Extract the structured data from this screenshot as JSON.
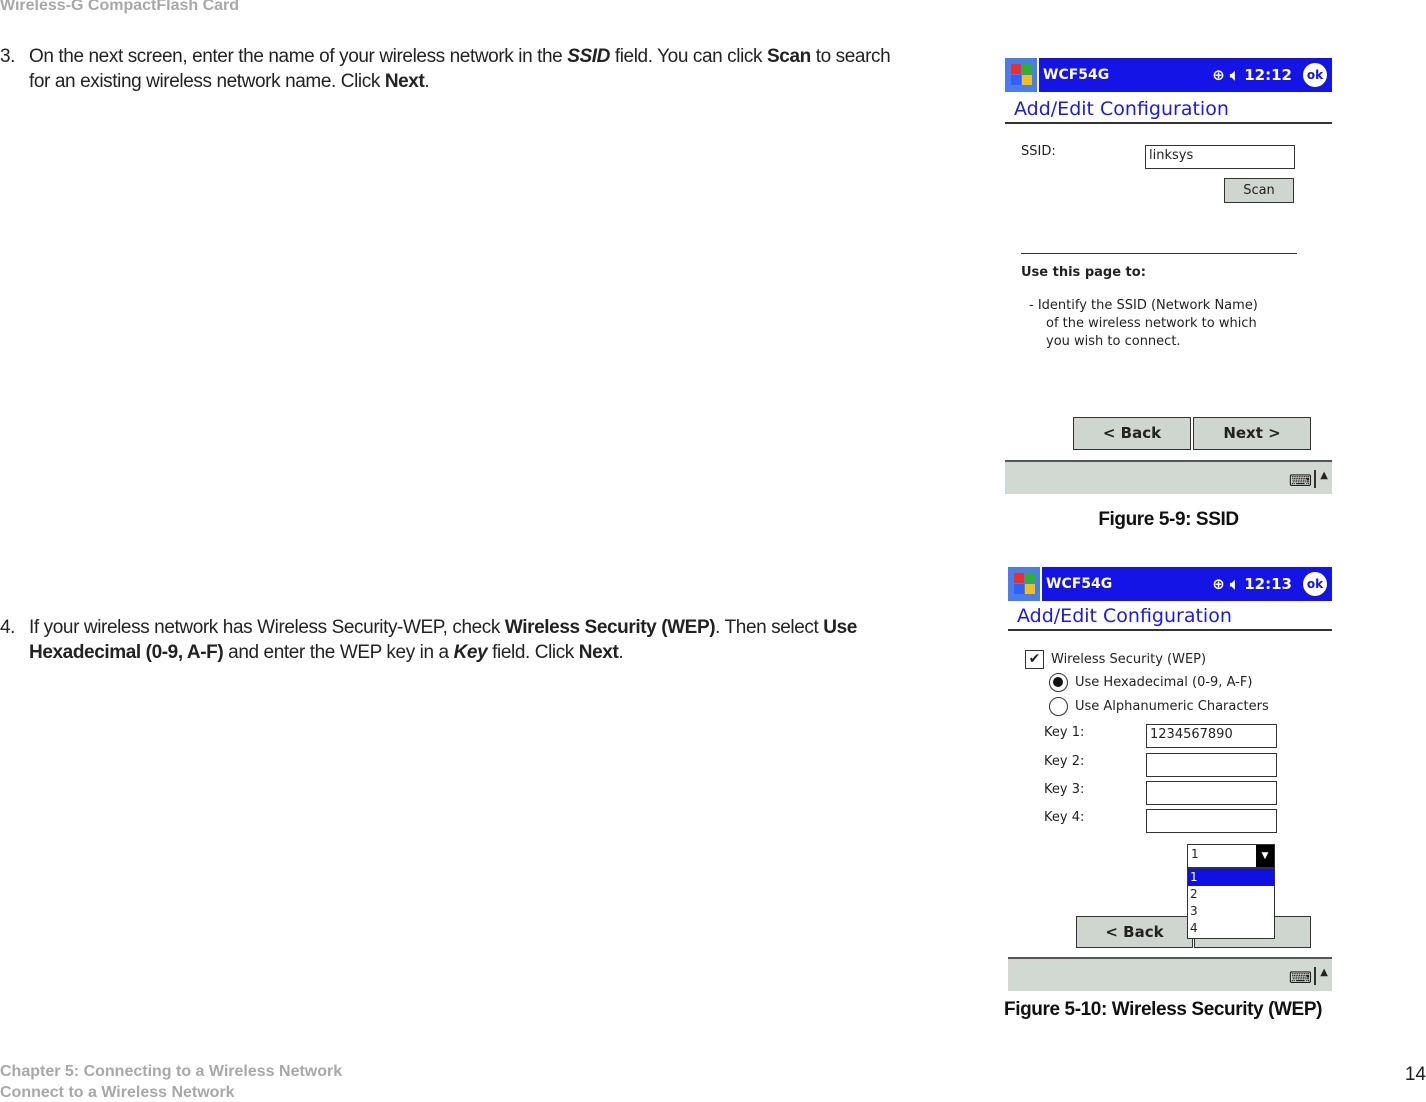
{
  "header": {
    "title": "Wireless-G CompactFlash Card"
  },
  "steps": [
    {
      "num": "3.",
      "parts": [
        "On the next screen, enter the name of your wireless network in the ",
        "SSID",
        " field. You can click ",
        "Scan",
        " to search for  an existing wireless network name. Click ",
        "Next",
        "."
      ]
    },
    {
      "num": "4.",
      "parts": [
        "If your wireless network has Wireless Security-WEP, check ",
        "Wireless Security (WEP)",
        ". Then select ",
        "Use Hexadecimal (0-9, A-F)",
        " and enter the WEP key in a ",
        "Key",
        " field. Click ",
        "Next",
        "."
      ]
    }
  ],
  "figure1": {
    "app_title": "WCF54G",
    "time": "12:12",
    "ok_label": "ok",
    "page_title": "Add/Edit Configuration",
    "ssid_label": "SSID:",
    "ssid_value": "linksys",
    "scan_label": "Scan",
    "help_heading": "Use this page to:",
    "help_lines": [
      "-  Identify the SSID (Network Name)",
      "of the wireless network to which",
      "you wish to connect."
    ],
    "back_label": "< Back",
    "next_label": "Next >",
    "caption": "Figure 5-9: SSID"
  },
  "figure2": {
    "app_title": "WCF54G",
    "time": "12:13",
    "ok_label": "ok",
    "page_title": "Add/Edit Configuration",
    "wep_label": "Wireless Security (WEP)",
    "wep_checked": true,
    "radio_hex": "Use Hexadecimal (0-9, A-F)",
    "radio_alpha": "Use Alphanumeric Characters",
    "selected_radio": "hex",
    "keys": [
      {
        "label": "Key 1:",
        "value": "1234567890"
      },
      {
        "label": "Key 2:",
        "value": ""
      },
      {
        "label": "Key 3:",
        "value": ""
      },
      {
        "label": "Key 4:",
        "value": ""
      }
    ],
    "dropdown_value": "1",
    "dropdown_options": [
      "1",
      "2",
      "3",
      "4"
    ],
    "back_label": "< Back",
    "caption": "Figure 5-10: Wireless Security (WEP)"
  },
  "colors": {
    "titlebar": "#1414e6",
    "accent_text": "#1a1ae6",
    "header_gray": "#a8a8a8",
    "button_bg": "#cfd6cf"
  },
  "footer": {
    "chapter": "Chapter 5: Connecting to a Wireless Network",
    "section": "Connect to a Wireless Network",
    "page": "14"
  }
}
